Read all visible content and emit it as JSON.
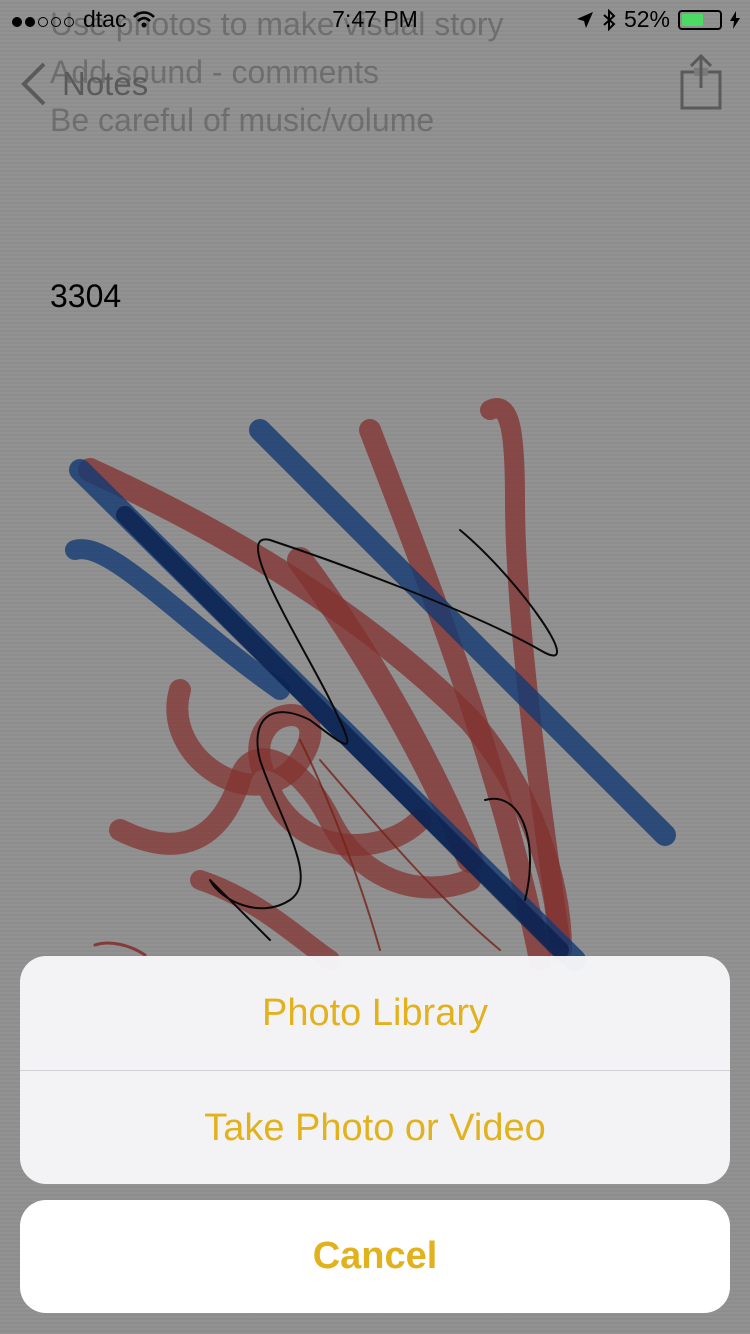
{
  "status_bar": {
    "carrier": "dtac",
    "time": "7:47 PM",
    "battery": "52%",
    "signal_dots_filled": 2,
    "signal_dots_total": 5
  },
  "nav": {
    "back_label": "Notes"
  },
  "note": {
    "faded_lines": [
      "Use photos to make visual story",
      "Add sound - comments",
      "Be careful of music/volume"
    ],
    "number": "3304"
  },
  "action_sheet": {
    "options": [
      "Photo Library",
      "Take Photo or Video"
    ],
    "cancel_label": "Cancel"
  },
  "colors": {
    "accent": "#e2b21e",
    "battery_fill": "#4cd964",
    "marker_red": "#d9534f",
    "marker_blue": "#1f5fbf"
  }
}
